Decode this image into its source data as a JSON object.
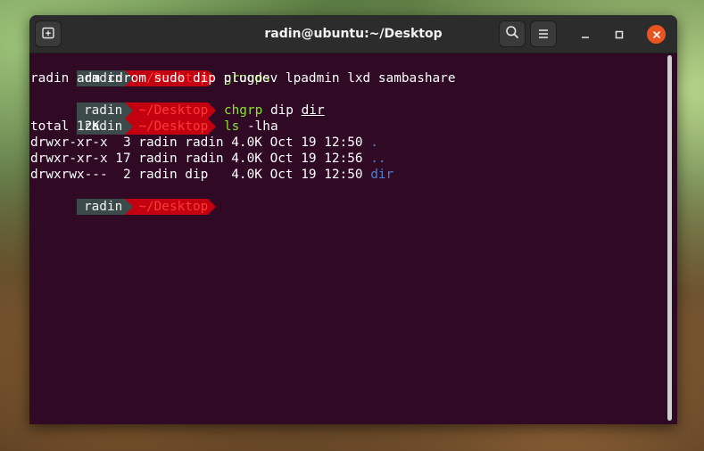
{
  "window": {
    "title": "radin@ubuntu:~/Desktop"
  },
  "icons": {
    "new_tab": "new-tab-icon",
    "search": "search-icon",
    "menu": "hamburger-menu-icon",
    "minimize": "minimize-icon",
    "maximize": "maximize-icon",
    "close": "close-icon"
  },
  "colors": {
    "terminal_bg": "#300a24",
    "prompt_user_bg": "#3c4a4a",
    "prompt_dir_bg": "#c3000f",
    "prompt_dir_fg": "#ff3838",
    "command_green": "#8ae234",
    "dir_blue": "#4a7fd6",
    "close_button": "#e95420"
  },
  "prompt": {
    "user": "radin",
    "dir": "~/Desktop"
  },
  "lines": {
    "cmd1": "groups",
    "out1": "radin adm cdrom sudo dip plugdev lpadmin lxd sambashare",
    "cmd2_name": "chgrp",
    "cmd2_arg1": " dip ",
    "cmd2_arg2": "dir",
    "cmd3_name": "ls",
    "cmd3_args": " -lha",
    "total": "total 12K",
    "ls_rows": [
      {
        "meta": "drwxr-xr-x  3 radin radin 4.0K Oct 19 12:50 ",
        "name": "."
      },
      {
        "meta": "drwxr-xr-x 17 radin radin 4.0K Oct 19 12:56 ",
        "name": ".."
      },
      {
        "meta": "drwxrwx---  2 radin dip   4.0K Oct 19 12:50 ",
        "name": "dir"
      }
    ]
  }
}
